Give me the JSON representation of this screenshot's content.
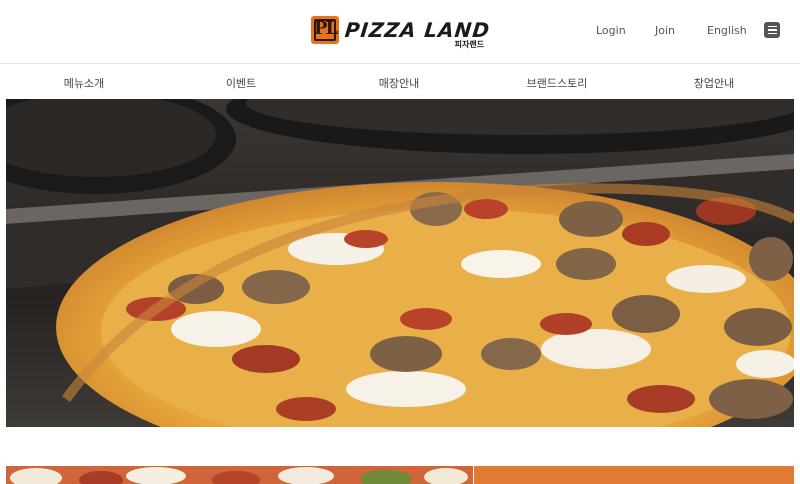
{
  "header": {
    "logo": {
      "text_en": "PIZZA LAND",
      "text_kr": "피자랜드",
      "mark": "PL"
    },
    "util": {
      "login": "Login",
      "join": "Join",
      "language": "English"
    },
    "menu_icon": "hamburger-menu-icon"
  },
  "nav": {
    "items": [
      {
        "label": "메뉴소개"
      },
      {
        "label": "이벤트"
      },
      {
        "label": "매장안내"
      },
      {
        "label": "브랜드스토리"
      },
      {
        "label": "창업안내"
      }
    ]
  },
  "colors": {
    "brand_orange": "#e8731c",
    "text_dark": "#1a1a1a",
    "nav_text": "#444444",
    "border": "#e3e3e3"
  }
}
